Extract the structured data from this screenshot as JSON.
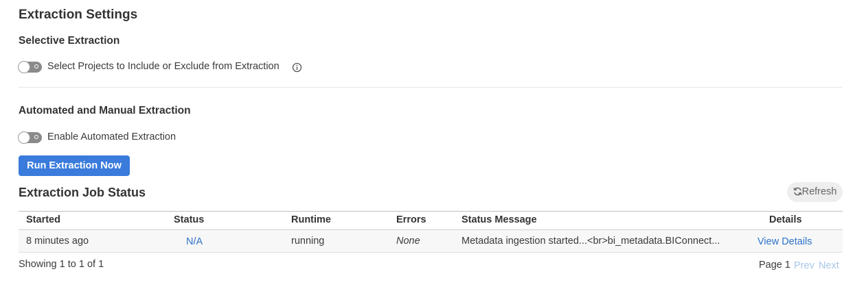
{
  "page": {
    "title": "Extraction Settings"
  },
  "selective": {
    "heading": "Selective Extraction",
    "toggle_label": "Select Projects to Include or Exclude from Extraction",
    "toggle_on": false
  },
  "automated": {
    "heading": "Automated and Manual Extraction",
    "toggle_label": "Enable Automated Extraction",
    "toggle_on": false,
    "run_button": "Run Extraction Now"
  },
  "jobs": {
    "heading": "Extraction Job Status",
    "refresh_label": "Refresh",
    "columns": [
      "Started",
      "Status",
      "Runtime",
      "Errors",
      "Status Message",
      "Details"
    ],
    "rows": [
      {
        "started": "8 minutes ago",
        "status": "N/A",
        "runtime": "running",
        "errors": "None",
        "message": "Metadata ingestion started...<br>bi_metadata.BIConnect...",
        "details": "View Details"
      }
    ],
    "summary": "Showing 1 to 1 of 1",
    "pager": {
      "page_label": "Page 1",
      "prev": "Prev",
      "next": "Next"
    }
  }
}
